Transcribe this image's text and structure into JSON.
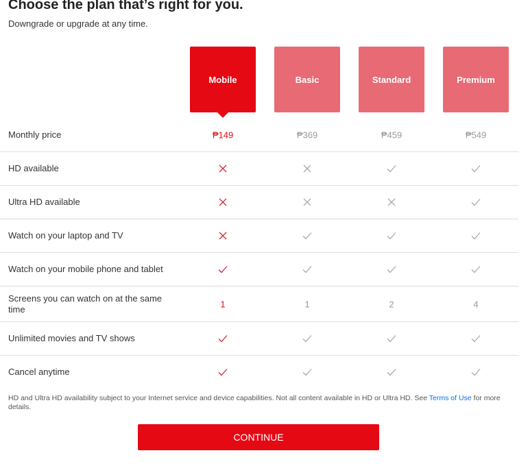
{
  "header": {
    "title": "Choose the plan that’s right for you.",
    "subtitle": "Downgrade or upgrade at any time."
  },
  "plans": [
    {
      "name": "Mobile",
      "selected": true
    },
    {
      "name": "Basic",
      "selected": false
    },
    {
      "name": "Standard",
      "selected": false
    },
    {
      "name": "Premium",
      "selected": false
    }
  ],
  "colors": {
    "accent": "#e50914",
    "plan_unselected": "#e86a74",
    "link": "#0071eb"
  },
  "features": [
    {
      "label": "Monthly price",
      "type": "text",
      "values": [
        "₱149",
        "₱369",
        "₱459",
        "₱549"
      ]
    },
    {
      "label": "HD available",
      "type": "bool",
      "values": [
        false,
        false,
        true,
        true
      ]
    },
    {
      "label": "Ultra HD available",
      "type": "bool",
      "values": [
        false,
        false,
        false,
        true
      ]
    },
    {
      "label": "Watch on your laptop and TV",
      "type": "bool",
      "values": [
        false,
        true,
        true,
        true
      ]
    },
    {
      "label": "Watch on your mobile phone and tablet",
      "type": "bool",
      "values": [
        true,
        true,
        true,
        true
      ]
    },
    {
      "label": "Screens you can watch on at the same time",
      "type": "text",
      "values": [
        "1",
        "1",
        "2",
        "4"
      ]
    },
    {
      "label": "Unlimited movies and TV shows",
      "type": "bool",
      "values": [
        true,
        true,
        true,
        true
      ]
    },
    {
      "label": "Cancel anytime",
      "type": "bool",
      "values": [
        true,
        true,
        true,
        true
      ]
    }
  ],
  "footnote": {
    "text_before": "HD and Ultra HD availability subject to your Internet service and device capabilities. Not all content available in HD or Ultra HD. See ",
    "link": "Terms of Use",
    "text_after": " for more details."
  },
  "continue_label": "CONTINUE"
}
